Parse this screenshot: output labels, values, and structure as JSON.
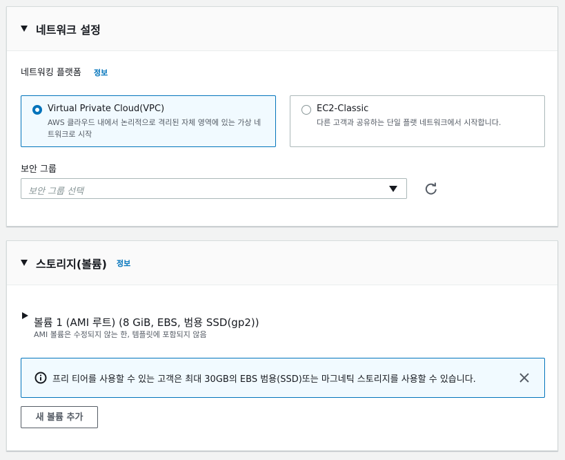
{
  "network": {
    "title": "네트워크 설정",
    "platform_label": "네트워킹 플랫폼",
    "info": "정보",
    "options": [
      {
        "title": "Virtual Private Cloud(VPC)",
        "desc": "AWS 클라우드 내에서 논리적으로 격리된 자체 영역에 있는 가상 네트워크로 시작",
        "selected": true
      },
      {
        "title": "EC2-Classic",
        "desc": "다른 고객과 공유하는 단일 플랫 네트워크에서 시작합니다.",
        "selected": false
      }
    ],
    "security_group_label": "보안 그룹",
    "security_group_placeholder": "보안 그룹 선택"
  },
  "storage": {
    "title": "스토리지(볼륨)",
    "info": "정보",
    "volume_title": "볼륨 1 (AMI 루트) (8 GiB, EBS, 범용 SSD(gp2))",
    "volume_note": "AMI 볼륨은 수정되지 않는 한, 템플릿에 포함되지 않음",
    "alert_text": "프리 티어를 사용할 수 있는 고객은 최대 30GB의 EBS 범용(SSD)또는 마그네틱 스토리지를 사용할 수 있습니다.",
    "add_volume_button": "새 볼륨 추가"
  },
  "colors": {
    "accent": "#0073bb",
    "selected_bg": "#f1faff",
    "border": "#aab7b8"
  },
  "icons": [
    "caret-down-icon",
    "radio-icon",
    "dropdown-caret-icon",
    "refresh-icon",
    "caret-right-icon",
    "info-icon",
    "close-icon"
  ]
}
